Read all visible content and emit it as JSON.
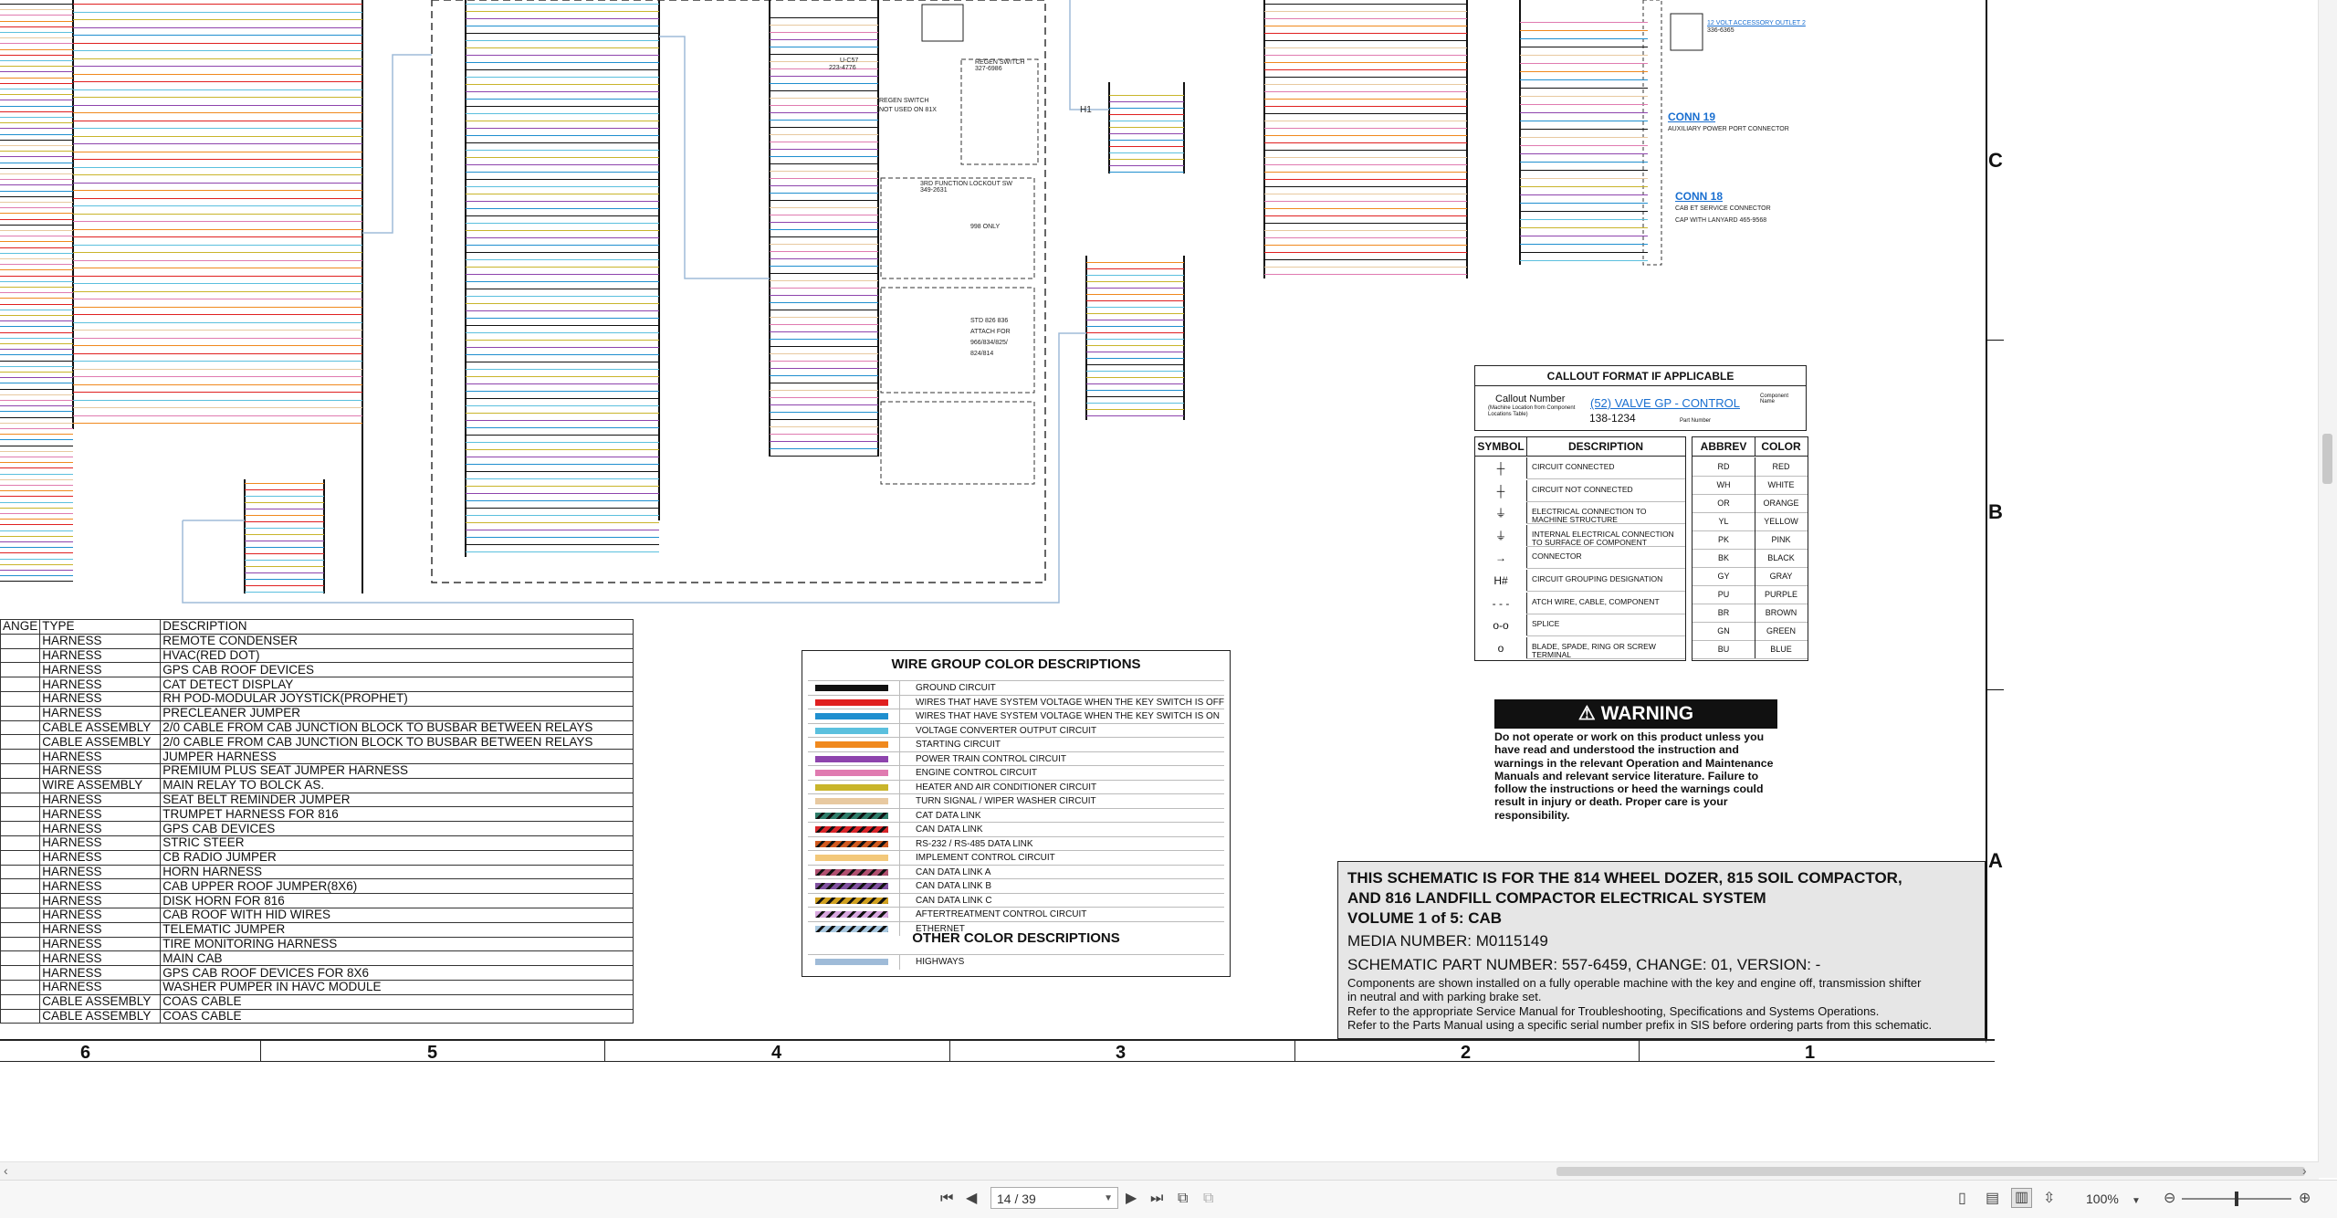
{
  "harness_table": {
    "header": [
      "ANGE",
      "TYPE",
      "DESCRIPTION"
    ],
    "rows": [
      [
        "",
        "HARNESS",
        "REMOTE CONDENSER"
      ],
      [
        "",
        "HARNESS",
        "HVAC(RED DOT)"
      ],
      [
        "",
        "HARNESS",
        "GPS CAB ROOF DEVICES"
      ],
      [
        "",
        "HARNESS",
        "CAT DETECT DISPLAY"
      ],
      [
        "",
        "HARNESS",
        "RH POD-MODULAR JOYSTICK(PROPHET)"
      ],
      [
        "",
        "HARNESS",
        "PRECLEANER JUMPER"
      ],
      [
        "",
        "CABLE ASSEMBLY",
        "2/0 CABLE FROM CAB JUNCTION BLOCK TO BUSBAR BETWEEN RELAYS"
      ],
      [
        "",
        "CABLE ASSEMBLY",
        "2/0 CABLE FROM CAB JUNCTION BLOCK TO BUSBAR BETWEEN RELAYS"
      ],
      [
        "",
        "HARNESS",
        "JUMPER HARNESS"
      ],
      [
        "",
        "HARNESS",
        "PREMIUM PLUS SEAT JUMPER HARNESS"
      ],
      [
        "",
        "WIRE ASSEMBLY",
        "MAIN RELAY TO BOLCK AS."
      ],
      [
        "",
        "HARNESS",
        "SEAT BELT REMINDER JUMPER"
      ],
      [
        "",
        "HARNESS",
        "TRUMPET HARNESS FOR 816"
      ],
      [
        "",
        "HARNESS",
        "GPS CAB DEVICES"
      ],
      [
        "",
        "HARNESS",
        "STRIC STEER"
      ],
      [
        "",
        "HARNESS",
        "CB RADIO JUMPER"
      ],
      [
        "",
        "HARNESS",
        "HORN HARNESS"
      ],
      [
        "",
        "HARNESS",
        "CAB UPPER ROOF JUMPER(8X6)"
      ],
      [
        "",
        "HARNESS",
        "DISK HORN FOR 816"
      ],
      [
        "",
        "HARNESS",
        "CAB ROOF WITH HID WIRES"
      ],
      [
        "",
        "HARNESS",
        "TELEMATIC JUMPER"
      ],
      [
        "",
        "HARNESS",
        "TIRE MONITORING HARNESS"
      ],
      [
        "",
        "HARNESS",
        "MAIN CAB"
      ],
      [
        "",
        "HARNESS",
        "GPS CAB ROOF DEVICES FOR 8X6"
      ],
      [
        "",
        "HARNESS",
        "WASHER PUMPER IN HAVC MODULE"
      ],
      [
        "",
        "CABLE ASSEMBLY",
        "COAS CABLE"
      ],
      [
        "",
        "CABLE ASSEMBLY",
        "COAS CABLE"
      ]
    ]
  },
  "wire_group": {
    "title": "WIRE GROUP COLOR DESCRIPTIONS",
    "items": [
      {
        "label": "GROUND CIRCUIT",
        "color": "#111111",
        "pattern": "solid"
      },
      {
        "label": "WIRES THAT HAVE SYSTEM VOLTAGE WHEN THE KEY SWITCH IS OFF",
        "color": "#e02020",
        "pattern": "solid"
      },
      {
        "label": "WIRES THAT HAVE SYSTEM VOLTAGE WHEN THE KEY SWITCH IS ON",
        "color": "#1f8fcf",
        "pattern": "solid"
      },
      {
        "label": "VOLTAGE CONVERTER OUTPUT CIRCUIT",
        "color": "#5bc0de",
        "pattern": "solid"
      },
      {
        "label": "STARTING CIRCUIT",
        "color": "#f0891e",
        "pattern": "solid"
      },
      {
        "label": "POWER TRAIN CONTROL CIRCUIT",
        "color": "#8e44ad",
        "pattern": "solid"
      },
      {
        "label": "ENGINE CONTROL CIRCUIT",
        "color": "#e07bb0",
        "pattern": "solid"
      },
      {
        "label": "HEATER AND AIR CONDITIONER CIRCUIT",
        "color": "#c9b52b",
        "pattern": "solid"
      },
      {
        "label": "TURN SIGNAL / WIPER WASHER CIRCUIT",
        "color": "#e8c9a0",
        "pattern": "solid"
      },
      {
        "label": "CAT DATA LINK",
        "color": "#2e7d6a",
        "pattern": "stripe"
      },
      {
        "label": "CAN DATA LINK",
        "color": "#d8262a",
        "pattern": "stripe"
      },
      {
        "label": "RS-232 / RS-485 DATA LINK",
        "color": "#d05a20",
        "pattern": "stripe"
      },
      {
        "label": "IMPLEMENT CONTROL CIRCUIT",
        "color": "#f3c87a",
        "pattern": "solid"
      },
      {
        "label": "CAN DATA LINK A",
        "color": "#b05070",
        "pattern": "stripe"
      },
      {
        "label": "CAN DATA LINK B",
        "color": "#8050a0",
        "pattern": "stripe"
      },
      {
        "label": "CAN DATA LINK C",
        "color": "#d0a020",
        "pattern": "stripe"
      },
      {
        "label": "AFTERTREATMENT CONTROL CIRCUIT",
        "color": "#d8a8e0",
        "pattern": "stripe"
      },
      {
        "label": "ETHERNET",
        "color": "#a8c8e0",
        "pattern": "stripe"
      }
    ],
    "other_title": "OTHER COLOR DESCRIPTIONS",
    "other_items": [
      {
        "label": "HIGHWAYS",
        "color": "#9fbbd8",
        "pattern": "solid"
      }
    ]
  },
  "callout": {
    "title": "CALLOUT FORMAT IF APPLICABLE",
    "callout_number": "Callout Number",
    "location_note": "(Machine Location from Component Locations Table)",
    "component": "(52) VALVE GP - CONTROL",
    "component_name": "Component Name",
    "part": "138-1234",
    "part_number": "Part Number"
  },
  "symbols": {
    "headers": [
      "SYMBOL",
      "DESCRIPTION"
    ],
    "rows": [
      {
        "glyph": "┼",
        "desc": "CIRCUIT CONNECTED"
      },
      {
        "glyph": "┼",
        "desc": "CIRCUIT NOT CONNECTED"
      },
      {
        "glyph": "⏚",
        "desc": "ELECTRICAL CONNECTION TO MACHINE STRUCTURE"
      },
      {
        "glyph": "⏚",
        "desc": "INTERNAL ELECTRICAL CONNECTION TO SURFACE OF COMPONENT"
      },
      {
        "glyph": "→",
        "desc": "CONNECTOR"
      },
      {
        "glyph": "H#",
        "desc": "CIRCUIT GROUPING DESIGNATION"
      },
      {
        "glyph": "- - -",
        "desc": "ATCH WIRE, CABLE, COMPONENT"
      },
      {
        "glyph": "o-o",
        "desc": "SPLICE"
      },
      {
        "glyph": "o",
        "desc": "BLADE, SPADE, RING OR SCREW TERMINAL"
      }
    ]
  },
  "abbrev": {
    "headers": [
      "ABBREV",
      "COLOR"
    ],
    "rows": [
      [
        "RD",
        "RED"
      ],
      [
        "WH",
        "WHITE"
      ],
      [
        "OR",
        "ORANGE"
      ],
      [
        "YL",
        "YELLOW"
      ],
      [
        "PK",
        "PINK"
      ],
      [
        "BK",
        "BLACK"
      ],
      [
        "GY",
        "GRAY"
      ],
      [
        "PU",
        "PURPLE"
      ],
      [
        "BR",
        "BROWN"
      ],
      [
        "GN",
        "GREEN"
      ],
      [
        "BU",
        "BLUE"
      ]
    ]
  },
  "warning": {
    "title": "WARNING",
    "text": "Do not operate or work on this product unless you have read and understood the instruction and warnings in the relevant Operation and Maintenance Manuals and relevant service literature. Failure to follow the instructions or heed the warnings could result in injury or death. Proper care is your responsibility."
  },
  "title_block": {
    "line1": "THIS SCHEMATIC IS FOR THE 814 WHEEL DOZER, 815 SOIL COMPACTOR,",
    "line2": "AND 816 LANDFILL COMPACTOR ELECTRICAL SYSTEM",
    "line3": "VOLUME 1 of 5: CAB",
    "media": "MEDIA NUMBER: M0115149",
    "part": "SCHEMATIC PART NUMBER: 557-6459, CHANGE: 01, VERSION: -",
    "note1": "Components are shown installed on a fully operable machine with the key and engine off, transmission shifter",
    "note2": "in neutral and with parking brake set.",
    "note3": "Refer to the appropriate Service Manual for Troubleshooting, Specifications and Systems Operations.",
    "note4": "Refer to the Parts Manual using a specific serial number prefix in SIS before ordering parts from this schematic."
  },
  "zones": [
    "6",
    "5",
    "4",
    "3",
    "2",
    "1"
  ],
  "rows": [
    "C",
    "B",
    "A"
  ],
  "components": {
    "conn19": "CONN 19",
    "conn19_desc": "AUXILIARY POWER PORT CONNECTOR",
    "conn18": "CONN 18",
    "conn18_desc": "CAB ET SERVICE CONNECTOR",
    "conn18_desc2": "CAP WITH LANYARD 465-9568",
    "outlet": "12 VOLT ACCESSORY OUTLET 2",
    "outlet_part": "336-6365",
    "regen": "REGEN SWITCH",
    "regen_note": "NOT USED ON 81X",
    "lockout": "3RD FUNCTION LOCKOUT SW",
    "lockout_part": "349-2631",
    "std": "STD 826 836",
    "attach": "ATTACH FOR",
    "attach_models": "966/834/825/",
    "attach_models2": "824/814",
    "h1": "H1",
    "regen_sw": "REGEN SWITCH",
    "regen_sw_part": "327-6986",
    "u_c57": "U-C57",
    "u_c57_part": "223-4776",
    "se8": "998 ONLY"
  },
  "viewer": {
    "page_value": "14 / 39",
    "zoom": "100%"
  }
}
